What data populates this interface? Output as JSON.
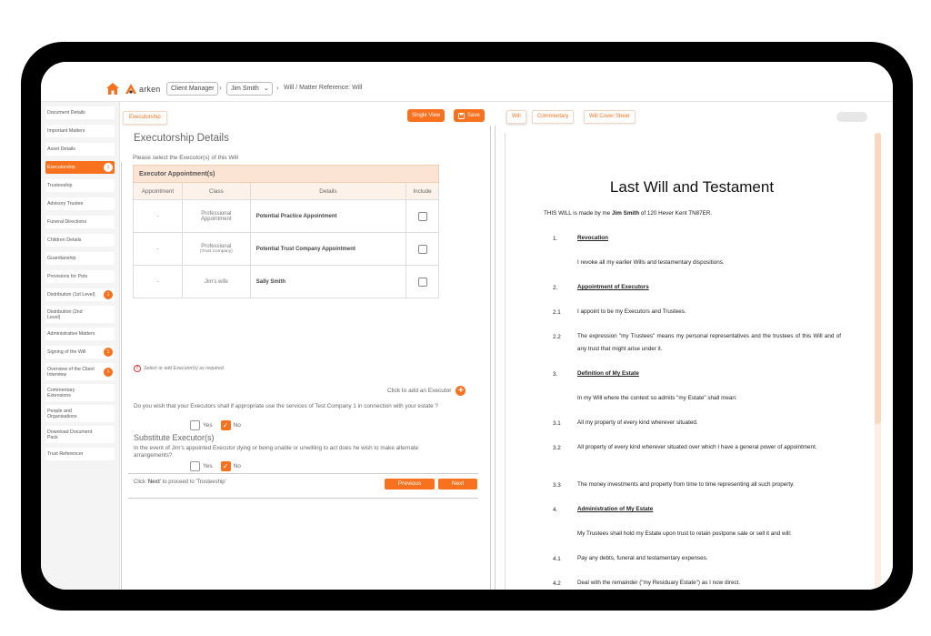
{
  "header": {
    "logo_text": "arken",
    "client_manager_label": "Client Manager",
    "client_selector_label": "Jim Smith",
    "matter_reference": "Will / Matter Reference: Will"
  },
  "sidebar": {
    "items": [
      {
        "label": "Document Details",
        "badge": ""
      },
      {
        "label": "Important Matters",
        "badge": ""
      },
      {
        "label": "Asset Details",
        "badge": ""
      },
      {
        "label": "Executorship",
        "badge": "1"
      },
      {
        "label": "Trusteeship",
        "badge": ""
      },
      {
        "label": "Advisory Trustee",
        "badge": ""
      },
      {
        "label": "Funeral Directions",
        "badge": ""
      },
      {
        "label": "Children Details",
        "badge": ""
      },
      {
        "label": "Guardianship",
        "badge": ""
      },
      {
        "label": "Provisions for Pets",
        "badge": ""
      },
      {
        "label": "Distribution (1st Level)",
        "badge": "1"
      },
      {
        "label": "Distribution (2nd Level)",
        "badge": ""
      },
      {
        "label": "Administrative Matters",
        "badge": ""
      },
      {
        "label": "Signing of the Will",
        "badge": "1"
      },
      {
        "label": "Overview of the Client Interview",
        "badge": "1"
      },
      {
        "label": "Commentary Extensions",
        "badge": ""
      },
      {
        "label": "People and Organisations",
        "badge": ""
      },
      {
        "label": "Download Document Pack",
        "badge": ""
      },
      {
        "label": "Trust Referencer",
        "badge": ""
      }
    ]
  },
  "form": {
    "tab_label": "Executorship",
    "single_view_label": "Single View",
    "save_label": "Save",
    "title": "Executorship Details",
    "subtitle": "Please select the Executor(s) of this Will",
    "table_caption": "Executor Appointment(s)",
    "columns": [
      "Appointment",
      "Class",
      "Details",
      "Include"
    ],
    "rows": [
      {
        "appointment": "-",
        "class": "Professional Appointment",
        "class_sub": "",
        "details": "Potential Practice Appointment"
      },
      {
        "appointment": "-",
        "class": "Professional",
        "class_sub": "(Trust Company)",
        "details": "Potential Trust Company Appointment"
      },
      {
        "appointment": "-",
        "class": "Jim's wife",
        "class_sub": "",
        "details": "Sally Smith"
      }
    ],
    "warning": "Select or add Executor(s) as required.",
    "add_executor_label": "Click to add an Executor",
    "question1": "Do you wish that your Executors shall if appropriate use the services of Test Company 1 in connection with your estate ?",
    "yes_label": "Yes",
    "no_label": "No",
    "substitute_title": "Substitute Executor(s)",
    "question2": "In the event of Jim's appointed Executor dying or being unable or unwilling to act does he wish to make alternate arrangements?",
    "next_hint_prefix": "Click '",
    "next_hint_bold": "Next",
    "next_hint_suffix": "' to proceed to 'Trusteeship'",
    "previous_label": "Previous",
    "next_label": "Next"
  },
  "document": {
    "tabs": [
      "Will",
      "Commentary",
      "Will Cover Sheet"
    ],
    "title": "Last Will and Testament",
    "intro_prefix": "THIS WILL is made by me",
    "intro_name": "Jim Smith",
    "intro_suffix": "of 120 Hever Kent TN87ER.",
    "sections": [
      {
        "num": "1.",
        "text": "Revocation",
        "heading": true
      },
      {
        "num": "",
        "text": "I revoke all my earlier Wills and testamentary dispositions.",
        "heading": false
      },
      {
        "num": "2.",
        "text": "Appointment of Executors",
        "heading": true
      },
      {
        "num": "2.1",
        "text": "I appoint to be my Executors and Trustees.",
        "heading": false
      },
      {
        "num": "2.2",
        "text": "The expression \"my Trustees\" means my personal representatives and the trustees of this Will and of any trust that might arise under it.",
        "heading": false
      },
      {
        "num": "3.",
        "text": "Definition of My Estate",
        "heading": true
      },
      {
        "num": "",
        "text": "In my Will where the context so admits \"my Estate\" shall mean:",
        "heading": false
      },
      {
        "num": "3.1",
        "text": "All my property of every kind wherever situated.",
        "heading": false
      },
      {
        "num": "3.2",
        "text": "All property of every kind wherever situated over which I have a general power of appointment.",
        "heading": false
      },
      {
        "num": "3.3",
        "text": "The money investments and property from time to time representing all such property.",
        "heading": false
      },
      {
        "num": "4.",
        "text": "Administration of My Estate",
        "heading": true
      },
      {
        "num": "",
        "text": "My Trustees shall hold my Estate upon trust to retain postpone sale or sell it and will:",
        "heading": false
      },
      {
        "num": "4.1",
        "text": "Pay any debts, funeral and testamentary expenses.",
        "heading": false
      },
      {
        "num": "4.2",
        "text": "Deal with the remainder (\"my Residuary Estate\") as I now direct.",
        "heading": false
      }
    ]
  },
  "colors": {
    "accent": "#f7711e",
    "frame": "#000000"
  }
}
